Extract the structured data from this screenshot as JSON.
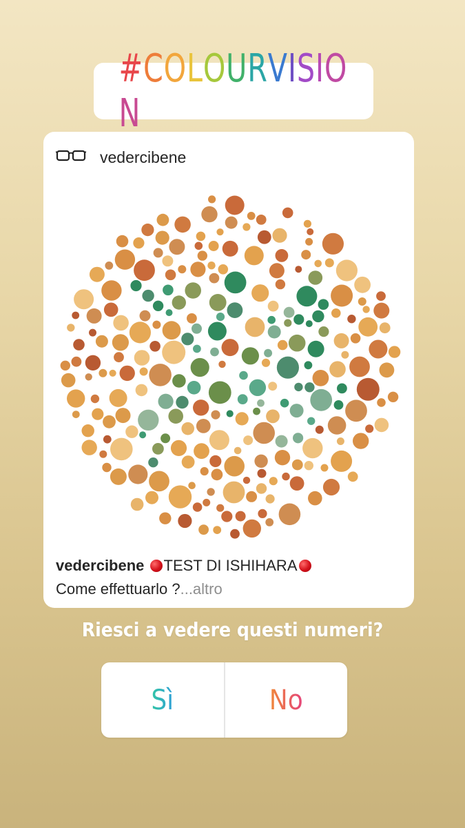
{
  "sticker": {
    "hashtag": "#COLOURVISION",
    "colors": [
      "#e8464a",
      "#ee7d3a",
      "#f2a63c",
      "#e9c43b",
      "#a6c83c",
      "#41b16a",
      "#2ba6a6",
      "#3a7ad0",
      "#6f4fc4",
      "#a24bc7",
      "#b84ab5",
      "#c04aa3",
      "#c84a92"
    ]
  },
  "post": {
    "username": "vedercibene",
    "caption_user": "vedercibene",
    "caption_title": "TEST DI ISHIHARA",
    "caption_line2": "Come effettuarlo ?",
    "caption_more": "...altro",
    "image": "ishihara-plate-74"
  },
  "question": "Riesci a vedere questi numeri?",
  "poll": {
    "option_yes": "Sì",
    "option_no": "No"
  }
}
